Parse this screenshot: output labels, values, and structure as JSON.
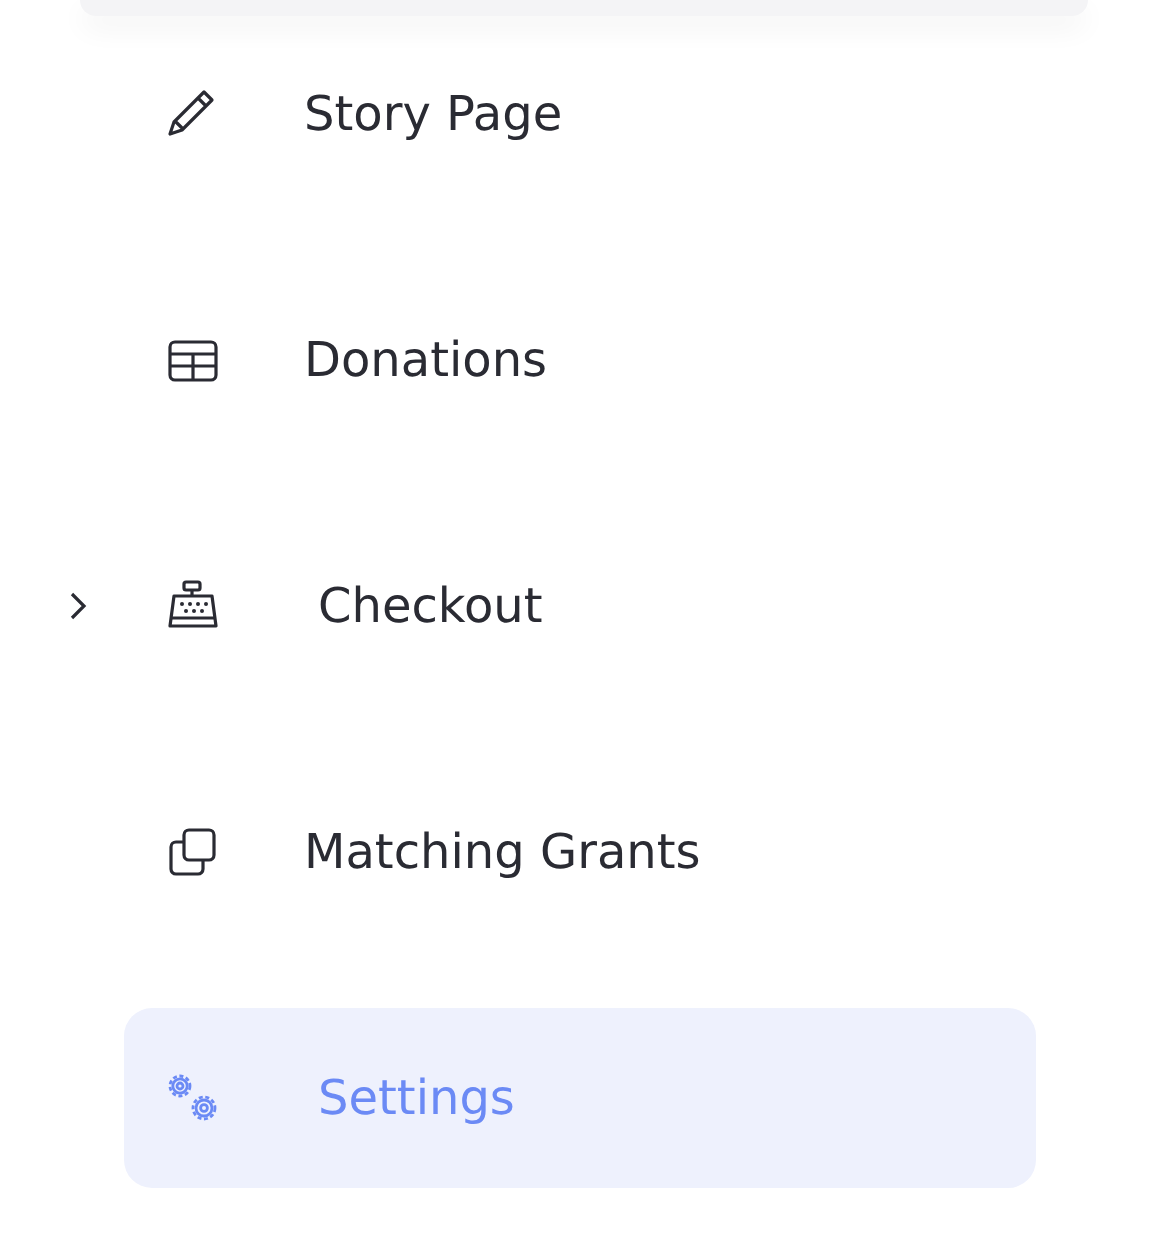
{
  "menu": [
    {
      "label": "Story Page",
      "selected": false
    },
    {
      "label": "Donations",
      "selected": false
    },
    {
      "label": "Checkout",
      "selected": false,
      "expanded": false
    },
    {
      "label": "Matching Grants",
      "selected": false
    },
    {
      "label": "Settings",
      "selected": true
    }
  ]
}
